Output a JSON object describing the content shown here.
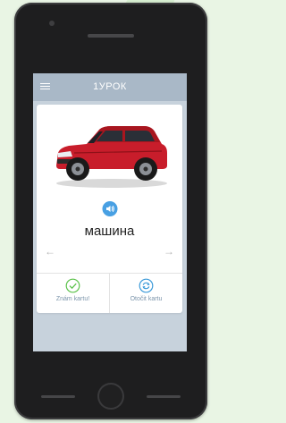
{
  "appbar": {
    "title": "1УРОК"
  },
  "card": {
    "word": "машина",
    "actions": [
      {
        "label": "Znám kartu!"
      },
      {
        "label": "Otočit kartu"
      }
    ]
  },
  "icons": {
    "menu": "hamburger-icon",
    "sound": "speaker-icon",
    "prev": "arrow-left-icon",
    "next": "arrow-right-icon",
    "known": "check-circle-icon",
    "flip": "refresh-icon"
  },
  "colors": {
    "appbar": "#a9b8c7",
    "screen": "#c7d2dc",
    "sound_button": "#48a0e3",
    "check_green": "#5cc24b",
    "flip_blue": "#3b9ad9",
    "car_red": "#c81d2b"
  }
}
